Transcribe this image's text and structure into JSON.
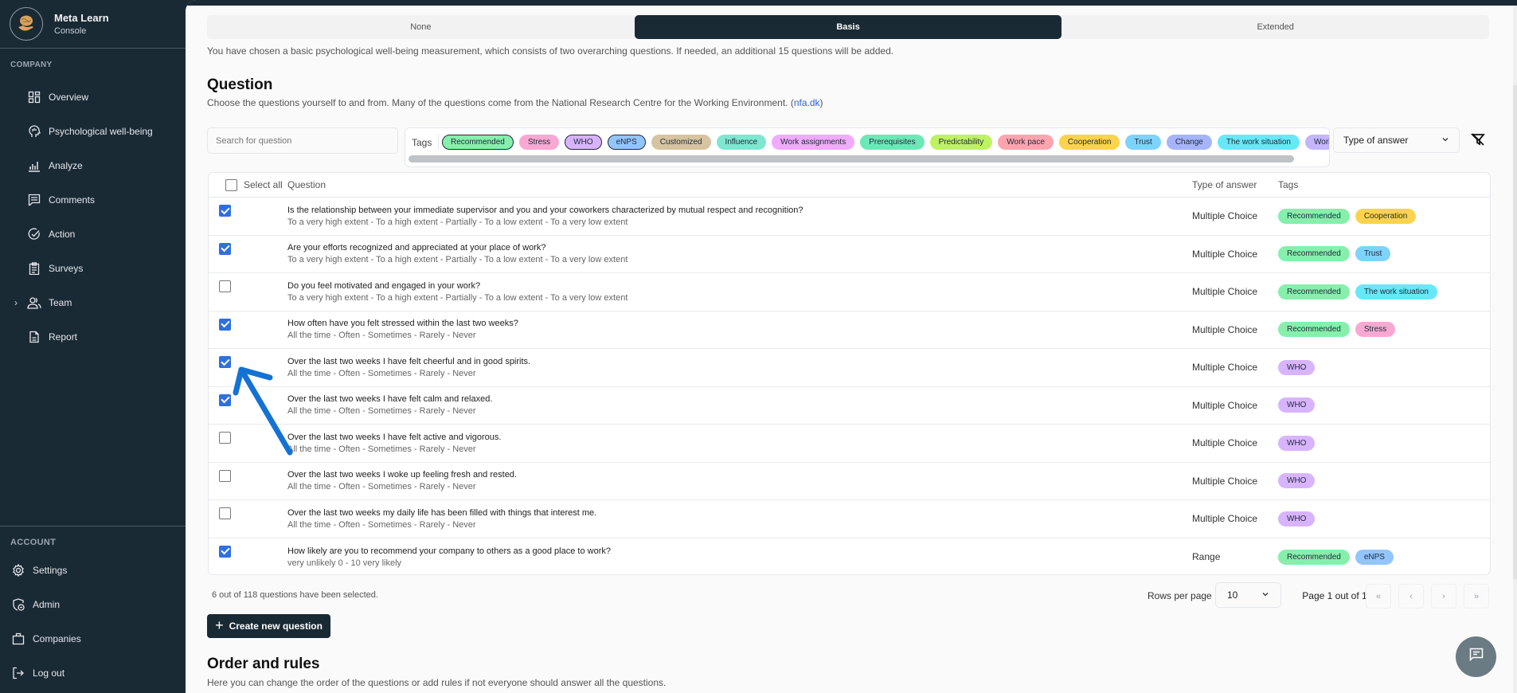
{
  "brand": {
    "name": "Meta Learn",
    "subtitle": "Console"
  },
  "sidebar": {
    "company_label": "COMPANY",
    "items": [
      {
        "label": "Overview",
        "icon": "dashboard-grid-icon"
      },
      {
        "label": "Psychological well-being",
        "icon": "head-brain-icon"
      },
      {
        "label": "Analyze",
        "icon": "bar-chart-icon"
      },
      {
        "label": "Comments",
        "icon": "comment-icon"
      },
      {
        "label": "Action",
        "icon": "check-circle-icon"
      },
      {
        "label": "Surveys",
        "icon": "clipboard-icon"
      },
      {
        "label": "Team",
        "icon": "users-icon",
        "expandable": true
      },
      {
        "label": "Report",
        "icon": "document-icon"
      }
    ],
    "account_label": "ACCOUNT",
    "account_items": [
      {
        "label": "Settings",
        "icon": "gear-icon"
      },
      {
        "label": "Admin",
        "icon": "shield-user-icon"
      },
      {
        "label": "Companies",
        "icon": "briefcase-icon"
      },
      {
        "label": "Log out",
        "icon": "logout-icon"
      }
    ]
  },
  "measurement": {
    "options": [
      "None",
      "Basis",
      "Extended"
    ],
    "selected": "Basis",
    "description": "You have chosen a basic psychological well-being measurement, which consists of two overarching questions. If needed, an additional 15 questions will be added."
  },
  "question_section": {
    "title": "Question",
    "subtitle_prefix": "Choose the questions yourself to and from. Many of the questions come from the National Research Centre for the Working Environment. (",
    "link_text": "nfa.dk",
    "subtitle_suffix": ")",
    "search_placeholder": "Search for question",
    "tags_label": "Tags",
    "type_filter_label": "Type of answer"
  },
  "tag_colors": {
    "Recommended": "#86efac",
    "Stress": "#f9a8d4",
    "WHO": "#d8b4fe",
    "eNPS": "#93c5fd",
    "Customized": "#d6c4a0",
    "Influence": "#7ee7d0",
    "Work assignments": "#f0abfc",
    "Prerequisites": "#6ee7b7",
    "Predictability": "#bef264",
    "Work pace": "#fda4af",
    "Cooperation": "#fcd34d",
    "Trust": "#7dd3fc",
    "Change": "#a5b4fc",
    "The work situation": "#67e8f9",
    "Work and private life": "#c4b5fd"
  },
  "filter_tags": [
    {
      "label": "Recommended",
      "selected": true
    },
    {
      "label": "Stress",
      "selected": false
    },
    {
      "label": "WHO",
      "selected": true
    },
    {
      "label": "eNPS",
      "selected": true
    },
    {
      "label": "Customized",
      "selected": false
    },
    {
      "label": "Influence",
      "selected": false
    },
    {
      "label": "Work assignments",
      "selected": false
    },
    {
      "label": "Prerequisites",
      "selected": false
    },
    {
      "label": "Predictability",
      "selected": false
    },
    {
      "label": "Work pace",
      "selected": false
    },
    {
      "label": "Cooperation",
      "selected": false
    },
    {
      "label": "Trust",
      "selected": false
    },
    {
      "label": "Change",
      "selected": false
    },
    {
      "label": "The work situation",
      "selected": false
    },
    {
      "label": "Work and private life",
      "selected": false
    }
  ],
  "table": {
    "headers": {
      "select_all": "Select all",
      "question": "Question",
      "type": "Type of answer",
      "tags": "Tags"
    },
    "select_all_checked": false,
    "rows": [
      {
        "checked": true,
        "question": "Is the relationship between your immediate supervisor and you and your coworkers characterized by mutual respect and recognition?",
        "options": "To a very high extent - To a high extent - Partially - To a low extent - To a very low extent",
        "type": "Multiple Choice",
        "tags": [
          "Recommended",
          "Cooperation"
        ]
      },
      {
        "checked": true,
        "question": "Are your efforts recognized and appreciated at your place of work?",
        "options": "To a very high extent - To a high extent - Partially - To a low extent - To a very low extent",
        "type": "Multiple Choice",
        "tags": [
          "Recommended",
          "Trust"
        ]
      },
      {
        "checked": false,
        "question": "Do you feel motivated and engaged in your work?",
        "options": "To a very high extent - To a high extent - Partially - To a low extent - To a very low extent",
        "type": "Multiple Choice",
        "tags": [
          "Recommended",
          "The work situation"
        ]
      },
      {
        "checked": true,
        "question": "How often have you felt stressed within the last two weeks?",
        "options": "All the time - Often - Sometimes - Rarely - Never",
        "type": "Multiple Choice",
        "tags": [
          "Recommended",
          "Stress"
        ]
      },
      {
        "checked": true,
        "question": "Over the last two weeks I have felt cheerful and in good spirits.",
        "options": "All the time - Often - Sometimes - Rarely - Never",
        "type": "Multiple Choice",
        "tags": [
          "WHO"
        ]
      },
      {
        "checked": true,
        "question": "Over the last two weeks I have felt calm and relaxed.",
        "options": "All the time - Often - Sometimes - Rarely - Never",
        "type": "Multiple Choice",
        "tags": [
          "WHO"
        ]
      },
      {
        "checked": false,
        "question": "Over the last two weeks I have felt active and vigorous.",
        "options": "All the time - Often - Sometimes - Rarely - Never",
        "type": "Multiple Choice",
        "tags": [
          "WHO"
        ]
      },
      {
        "checked": false,
        "question": "Over the last two weeks I woke up feeling fresh and rested.",
        "options": "All the time - Often - Sometimes - Rarely - Never",
        "type": "Multiple Choice",
        "tags": [
          "WHO"
        ]
      },
      {
        "checked": false,
        "question": "Over the last two weeks my daily life has been filled with things that interest me.",
        "options": "All the time - Often - Sometimes - Rarely - Never",
        "type": "Multiple Choice",
        "tags": [
          "WHO"
        ]
      },
      {
        "checked": true,
        "question": "How likely are you to recommend your company to others as a good place to work?",
        "options": "very unlikely 0 - 10 very likely",
        "type": "Range",
        "tags": [
          "Recommended",
          "eNPS"
        ]
      }
    ]
  },
  "footer": {
    "selected_count": "6 out of 118 questions have been selected.",
    "rows_per_page_label": "Rows per page",
    "rows_per_page": "10",
    "page_info": "Page 1 out of 1",
    "pager": {
      "first": "«",
      "prev": "‹",
      "next": "›",
      "last": "»"
    }
  },
  "create_button": {
    "label": "Create new question"
  },
  "order_section": {
    "title": "Order and rules",
    "subtitle": "Here you can change the order of the questions or add rules if not everyone should answer all the questions."
  },
  "colors": {
    "sidebar_bg": "#1a2a35",
    "accent_checkbox": "#2f6fe0",
    "link": "#2563eb",
    "annotation_arrow": "#1472d4"
  }
}
